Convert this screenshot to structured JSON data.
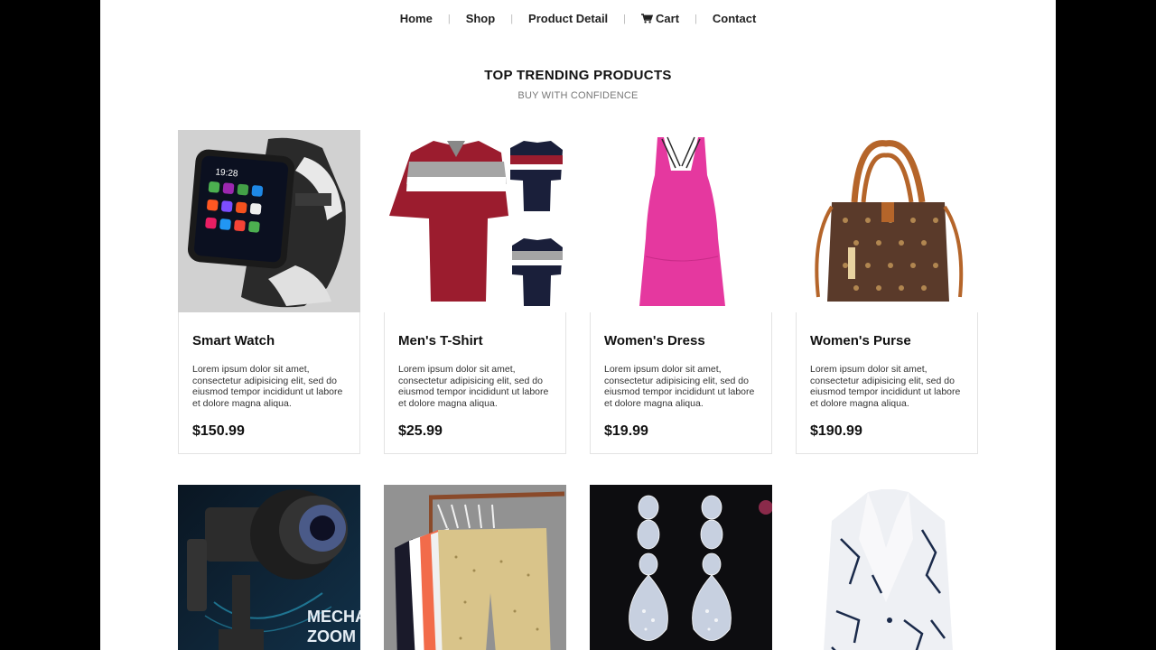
{
  "nav": {
    "items": [
      {
        "label": "Home"
      },
      {
        "label": "Shop"
      },
      {
        "label": "Product Detail"
      },
      {
        "label": "Cart",
        "icon": "cart-icon"
      },
      {
        "label": "Contact"
      }
    ]
  },
  "section": {
    "title": "TOP TRENDING PRODUCTS",
    "subtitle": "BUY WITH CONFIDENCE"
  },
  "products": [
    {
      "name": "Smart Watch",
      "description": "Lorem ipsum dolor sit amet, consectetur adipisicing elit, sed do eiusmod tempor incididunt ut labore et dolore magna aliqua.",
      "price": "$150.99"
    },
    {
      "name": "Men's T-Shirt",
      "description": "Lorem ipsum dolor sit amet, consectetur adipisicing elit, sed do eiusmod tempor incididunt ut labore et dolore magna aliqua.",
      "price": "$25.99"
    },
    {
      "name": "Women's Dress",
      "description": "Lorem ipsum dolor sit amet, consectetur adipisicing elit, sed do eiusmod tempor incididunt ut labore et dolore magna aliqua.",
      "price": "$19.99"
    },
    {
      "name": "Women's Purse",
      "description": "Lorem ipsum dolor sit amet, consectetur adipisicing elit, sed do eiusmod tempor incididunt ut labore et dolore magna aliqua.",
      "price": "$190.99"
    }
  ],
  "row2": {
    "gimbal_text_1": "MECHA",
    "gimbal_text_2": "ZOOM"
  },
  "watch_screen": {
    "time": "19:28"
  }
}
